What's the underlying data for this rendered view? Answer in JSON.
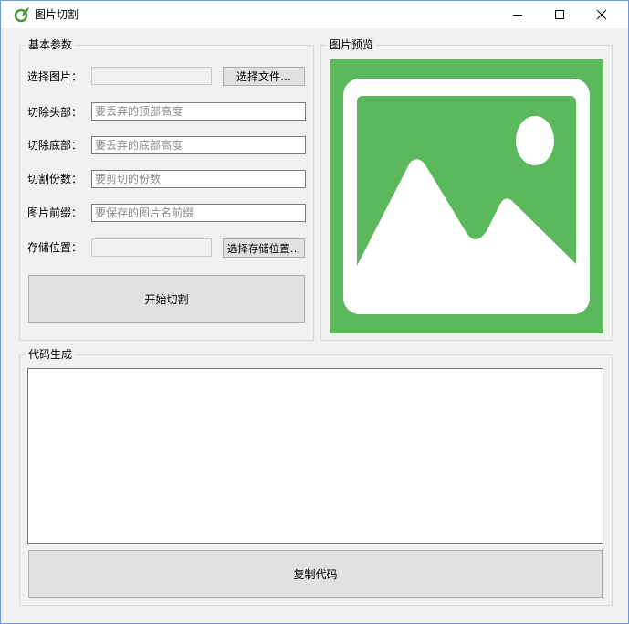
{
  "window": {
    "title": "图片切割",
    "icon": "app-leaf-icon",
    "controls": [
      "minimize-icon",
      "maximize-icon",
      "close-icon"
    ]
  },
  "basic_params": {
    "title": "基本参数",
    "select_image_label": "选择图片：",
    "select_image_value": "",
    "select_file_button": "选择文件…",
    "cut_top_label": "切除头部：",
    "cut_top_placeholder": "要丢弃的顶部高度",
    "cut_bottom_label": "切除底部：",
    "cut_bottom_placeholder": "要丢弃的底部高度",
    "parts_label": "切割份数：",
    "parts_placeholder": "要剪切的份数",
    "prefix_label": "图片前缀：",
    "prefix_placeholder": "要保存的图片名前缀",
    "save_location_label": "存储位置：",
    "save_location_value": "",
    "select_save_button": "选择存储位置…",
    "start_button": "开始切割"
  },
  "preview": {
    "title": "图片预览",
    "placeholder_icon": "image-placeholder-icon",
    "background_color": "#5cb85c"
  },
  "code_gen": {
    "title": "代码生成",
    "code_value": "",
    "copy_button": "复制代码"
  }
}
